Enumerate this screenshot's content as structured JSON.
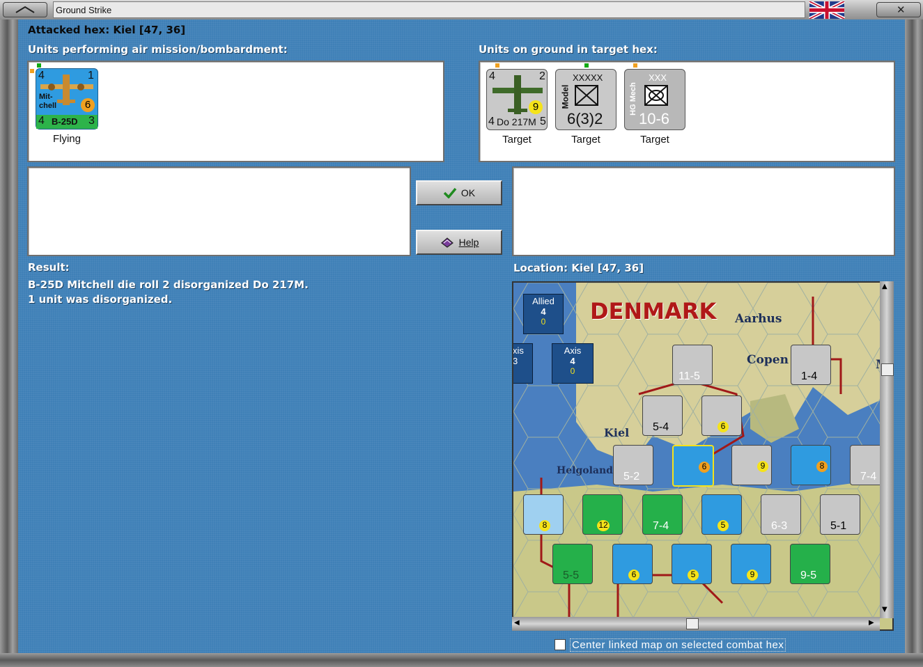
{
  "window": {
    "title": "Ground Strike"
  },
  "header": {
    "attacked_hex": "Attacked hex: Kiel  [47, 36]"
  },
  "air_units": {
    "heading": "Units performing air mission/bombardment:",
    "units": [
      {
        "name": "Mit-chell",
        "type": "B-25D",
        "top_left": "4",
        "top_right": "1",
        "badge": "6",
        "bottom_left": "4",
        "bottom_right": "3",
        "status": "Flying"
      }
    ]
  },
  "ground_units": {
    "heading": "Units on ground in target hex:",
    "units": [
      {
        "type": "Do 217M",
        "top_left": "4",
        "top_right": "2",
        "badge": "9",
        "bottom_left": "4",
        "bottom_right": "5",
        "status": "Target"
      },
      {
        "size": "XXXXX",
        "side": "Model",
        "strength": "6(3)2",
        "status": "Target"
      },
      {
        "size": "XXX",
        "side": "HG Mech",
        "strength": "10-6",
        "status": "Target"
      }
    ]
  },
  "buttons": {
    "ok": "OK",
    "help": "Help"
  },
  "result": {
    "heading": "Result:",
    "lines": [
      "B-25D Mitchell die roll 2 disorganized Do 217M.",
      "1 unit was disorganized."
    ]
  },
  "location": {
    "heading": "Location:  Kiel  [47, 36]"
  },
  "map": {
    "allied_label": "Allied",
    "allied_value": "4",
    "allied_sub": "0",
    "axis_label": "Axis",
    "axis_value": "4",
    "axis_sub": "0",
    "partial_label": "xis",
    "partial_value": "3",
    "country": "DENMARK",
    "cities": [
      "Aarhus",
      "Copen",
      "Kiel",
      "Helgoland",
      "Ma"
    ],
    "map_units": [
      "11-5",
      "1-4",
      "5-4",
      "6",
      "5-2",
      "6",
      "9",
      "8",
      "7-4",
      "8",
      "12",
      "7-4",
      "5",
      "6-3",
      "5-1",
      "5-5",
      "6",
      "5",
      "9",
      "9-5"
    ]
  },
  "options": {
    "center_map_label": "Center linked map on selected combat hex"
  }
}
